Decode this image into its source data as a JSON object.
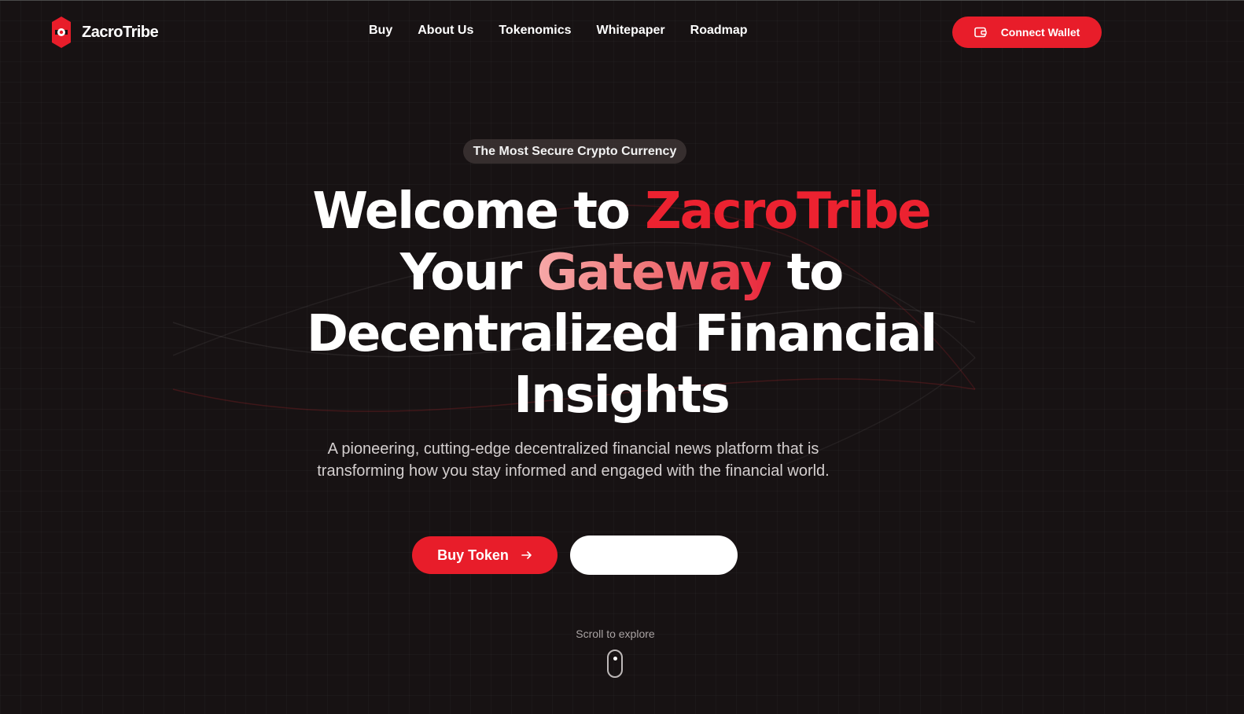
{
  "brand": {
    "name": "ZacroTribe",
    "accent": "#e81d2a"
  },
  "nav": {
    "items": [
      "Buy",
      "About Us",
      "Tokenomics",
      "Whitepaper",
      "Roadmap"
    ],
    "connect_label": "Connect Wallet",
    "connect_icon": "wallet-icon"
  },
  "hero": {
    "badge": "The Most Secure Crypto Currency",
    "line1_prefix": "Welcome to ",
    "line1_highlight": "ZacroTribe",
    "line2_prefix": "Your ",
    "line2_highlight": "Gateway",
    "line2_suffix": " to",
    "line3": "Decentralized Financial",
    "line4": "Insights",
    "description": "A pioneering, cutting-edge decentralized financial news platform that is transforming how you stay informed and engaged with the financial world.",
    "buy_label": "Buy Token",
    "buy_icon": "arrow-right-icon",
    "secondary_label": ""
  },
  "scroll": {
    "label": "Scroll to explore",
    "icon": "mouse-icon"
  }
}
